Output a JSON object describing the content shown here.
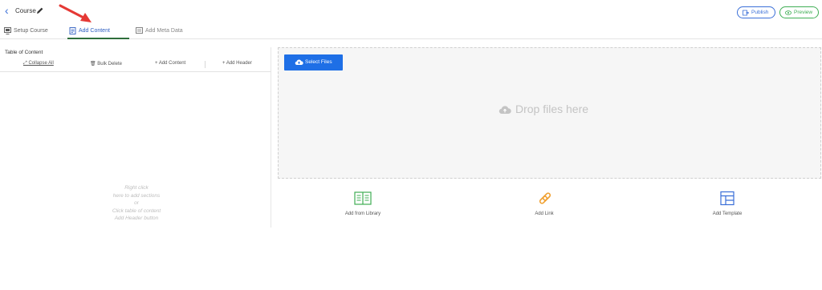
{
  "header": {
    "back_icon": "chevron-left-icon",
    "title": "Course",
    "edit_icon": "pencil-icon",
    "publish_label": "Publish",
    "preview_label": "Preview",
    "colors": {
      "accent": "#3a6fd8",
      "preview": "#3fae54",
      "annotation_arrow": "#e53935"
    }
  },
  "tabs": [
    {
      "label": "Setup Course",
      "icon": "setup-icon"
    },
    {
      "label": "Add Content",
      "icon": "document-icon",
      "active": true
    },
    {
      "label": "Add Meta Data",
      "icon": "metadata-icon"
    }
  ],
  "toc": {
    "title": "Table of Content",
    "actions": {
      "collapse_all": "Collapse All",
      "bulk_delete": "Bulk Delete",
      "add_content": "+ Add Content",
      "add_header": "+ Add Header"
    },
    "hint": [
      "Right click",
      "here to add sections",
      "or",
      "Click table of content",
      "Add Header button"
    ]
  },
  "upload": {
    "select_files_label": "Select Files",
    "drop_text": "Drop files here",
    "colors": {
      "button": "#1e6fe6"
    }
  },
  "options": [
    {
      "label": "Add from Library",
      "icon": "library-book-icon",
      "color": "#3fae54"
    },
    {
      "label": "Add Link",
      "icon": "link-icon",
      "color": "#f0a030"
    },
    {
      "label": "Add Template",
      "icon": "template-icon",
      "color": "#3a6fd8"
    }
  ]
}
